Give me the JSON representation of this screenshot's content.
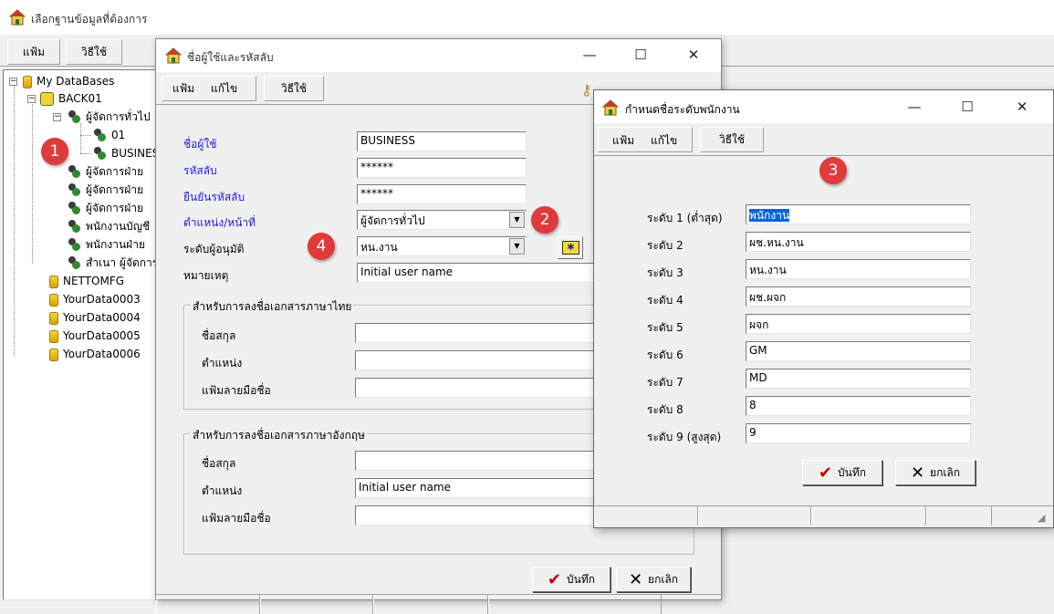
{
  "main_window": {
    "title": "เลือกฐานข้อมูลที่ต้องการ",
    "menu": [
      "แฟ้ม",
      "วิธีใช้"
    ]
  },
  "tree": {
    "root": "My DataBases",
    "items": [
      {
        "label": "BACK01"
      },
      {
        "label": "ผู้จัดการทั่วไป"
      },
      {
        "label": "01"
      },
      {
        "label": "BUSINESS"
      },
      {
        "label": "ผู้จัดการฝ่าย"
      },
      {
        "label": "ผู้จัดการฝ่าย"
      },
      {
        "label": "ผู้จัดการฝ่าย"
      },
      {
        "label": "พนักงานบัญชี"
      },
      {
        "label": "พนักงานฝ่าย"
      },
      {
        "label": "สำเนา ผู้จัดการ"
      },
      {
        "label": "NETTOMFG"
      },
      {
        "label": "YourData0003"
      },
      {
        "label": "YourData0004"
      },
      {
        "label": "YourData0005"
      },
      {
        "label": "YourData0006"
      }
    ]
  },
  "user_dialog": {
    "title": "ชื่อผู้ใช้และรหัสลับ",
    "menu": [
      "แฟ้ม",
      "แก้ไข",
      "วิธีใช้"
    ],
    "fields": {
      "username_label": "ชื่อผู้ใช้",
      "username_value": "BUSINESS",
      "password_label": "รหัสลับ",
      "password_value": "******",
      "confirm_label": "ยืนยันรหัสลับ",
      "confirm_value": "******",
      "position_label": "ตำแหน่ง/หน้าที่",
      "position_value": "ผู้จัดการทั่วไป",
      "approval_label": "ระดับผู้อนุมัติ",
      "approval_value": "หน.งาน",
      "note_label": "หมายเหตุ",
      "note_value": "Initial user name"
    },
    "thai_group": {
      "title": "สำหรับการลงชื่อเอกสารภาษาไทย",
      "name_label": "ชื่อสกุล",
      "name_value": "",
      "position_label": "ตำแหน่ง",
      "position_value": "",
      "signature_label": "แฟ้มลายมือชื่อ",
      "signature_value": ""
    },
    "english_group": {
      "title": "สำหรับการลงชื่อเอกสารภาษาอังกฤษ",
      "name_label": "ชื่อสกุล",
      "name_value": "",
      "position_label": "ตำแหน่ง",
      "position_value": "Initial user name",
      "signature_label": "แฟ้มลายมือชื่อ",
      "signature_value": ""
    },
    "save_label": "บันทึก",
    "cancel_label": "ยกเลิก"
  },
  "level_dialog": {
    "title": "กำหนดชื่อระดับพนักงาน",
    "menu": [
      "แฟ้ม",
      "แก้ไข",
      "วิธีใช้"
    ],
    "levels": [
      {
        "label": "ระดับ 1 (ต่ำสุด)",
        "value": "พนักงาน"
      },
      {
        "label": "ระดับ 2",
        "value": "ผช.หน.งาน"
      },
      {
        "label": "ระดับ 3",
        "value": "หน.งาน"
      },
      {
        "label": "ระดับ 4",
        "value": "ผช.ผจก"
      },
      {
        "label": "ระดับ 5",
        "value": "ผจก"
      },
      {
        "label": "ระดับ 6",
        "value": "GM"
      },
      {
        "label": "ระดับ 7",
        "value": "MD"
      },
      {
        "label": "ระดับ 8",
        "value": "8"
      },
      {
        "label": "ระดับ 9 (สูงสุด)",
        "value": "9"
      }
    ],
    "save_label": "บันทึก",
    "cancel_label": "ยกเลิก"
  },
  "badges": [
    "1",
    "2",
    "3",
    "4"
  ],
  "window_controls": {
    "minimize": "—",
    "maximize": "☐",
    "close": "✕"
  }
}
